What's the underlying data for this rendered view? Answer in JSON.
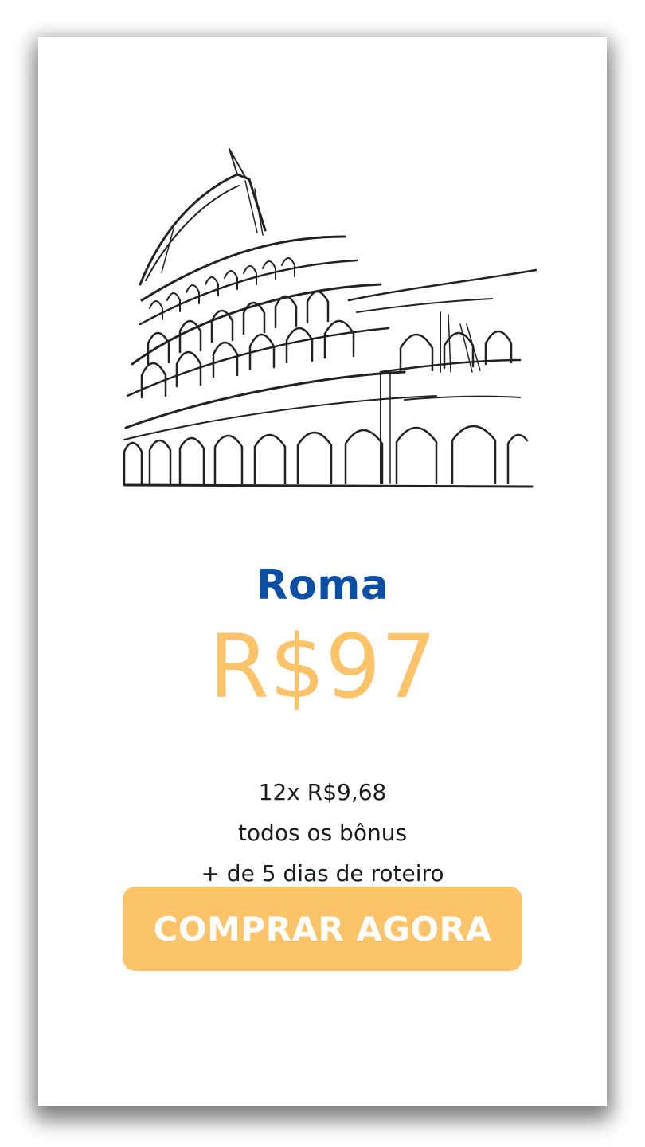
{
  "product": {
    "title": "Roma",
    "price": "R$97",
    "installments": "12x R$9,68",
    "bonus": "todos os bônus",
    "itinerary": "+ de 5 dias de roteiro"
  },
  "cta": {
    "label": "COMPRAR AGORA",
    "color": "#fcc369"
  },
  "colors": {
    "title": "#0a4ea6",
    "price": "#fcc369"
  },
  "illustration": {
    "icon": "colosseum-sketch-icon"
  }
}
